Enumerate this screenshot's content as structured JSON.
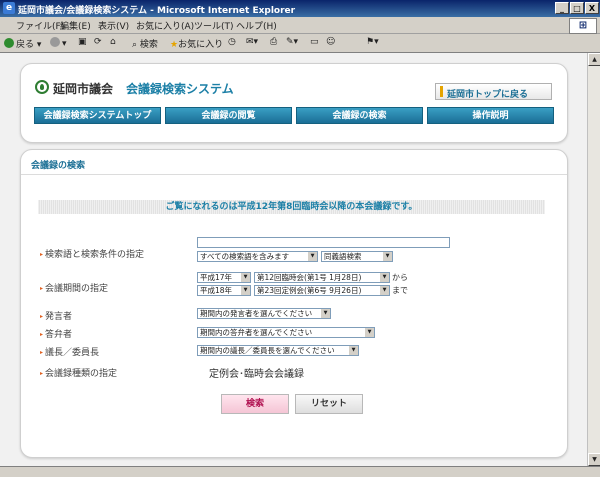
{
  "window": {
    "title": "延岡市議会/会議録検索システム - Microsoft Internet Explorer",
    "min": "_",
    "max": "□",
    "close": "X"
  },
  "menu": [
    "ファイル(F)",
    "編集(E)",
    "表示(V)",
    "お気に入り(A)",
    "ツール(T)",
    "ヘルプ(H)"
  ],
  "toolbar": {
    "back": "戻る",
    "search": "検索",
    "favorites": "お気に入り"
  },
  "header": {
    "site_name": "延岡市議会",
    "system_name": "会議録検索システム",
    "top_link": "延岡市トップに戻る"
  },
  "nav": [
    {
      "label": "会議録検索システムトップ"
    },
    {
      "label": "会議録の閲覧"
    },
    {
      "label": "会議録の検索"
    },
    {
      "label": "操作説明"
    }
  ],
  "search_section": {
    "title": "会議録の検索",
    "notice": "ご覧になれるのは平成12年第8回臨時会以降の本会議録です。"
  },
  "form": {
    "keyword_label": "検索語と検索条件の指定",
    "keyword_value": "",
    "condition": "すべての検索語を含みます",
    "synonym": "同義語検索",
    "period_label": "会議期間の指定",
    "from_year": "平成17年",
    "from_session": "第12回臨時会(第1号 1月28日)",
    "from_suffix": "から",
    "to_year": "平成18年",
    "to_session": "第23回定例会(第6号 9月26日)",
    "to_suffix": "まで",
    "speaker_label": "発言者",
    "speaker_value": "期間内の発言者を選んでください",
    "answerer_label": "答弁者",
    "answerer_value": "期間内の答弁者を選んでください",
    "chair_label": "議長／委員長",
    "chair_value": "期間内の議長／委員長を選んでください",
    "type_label": "会議録種類の指定",
    "type_value": "定例会･臨時会会議録",
    "search_button": "検索",
    "reset_button": "リセット"
  }
}
